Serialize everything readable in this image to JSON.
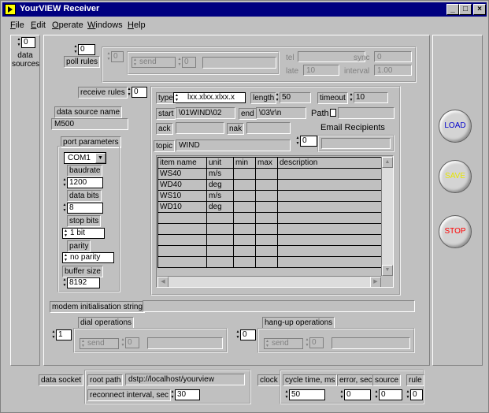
{
  "window": {
    "title": "YourVIEW Receiver",
    "minimize_glyph": "_",
    "maximize_glyph": "□",
    "close_glyph": "×"
  },
  "menu": [
    "File",
    "Edit",
    "Operate",
    "Windows",
    "Help"
  ],
  "data_sources": {
    "index": "0",
    "label": "data sources"
  },
  "poll_rules": {
    "label": "poll rules",
    "index": "0",
    "inner_index": "0",
    "mode": "send",
    "mode_index": "0",
    "fields": {
      "tel_label": "tel",
      "tel_value": "",
      "sync_label": "sync",
      "sync_value": "0",
      "late_label": "late",
      "late_value": "10",
      "interval_label": "interval",
      "interval_value": "1.00"
    }
  },
  "receive_rules": {
    "label": "receive rules",
    "index": "0",
    "type_label": "type",
    "type_value": "lxx.xlxx.xlxx.x",
    "length_label": "length",
    "length_value": "50",
    "timeout_label": "timeout",
    "timeout_value": "10",
    "start_label": "start",
    "start_value": "\\01WIND\\02",
    "end_label": "end",
    "end_value": "\\03\\r\\n",
    "path_label": "Path",
    "path_value": "",
    "ack_label": "ack",
    "ack_value": "",
    "nak_label": "nak",
    "nak_value": "",
    "email_label": "Email Recipients",
    "email_index": "0",
    "email_value": "",
    "topic_label": "topic",
    "topic_value": "WIND",
    "items_table": {
      "columns": [
        "item name",
        "unit",
        "min",
        "max",
        "description"
      ],
      "rows": [
        [
          "WS40",
          "m/s",
          "",
          "",
          ""
        ],
        [
          "WD40",
          "deg",
          "",
          "",
          ""
        ],
        [
          "WS10",
          "m/s",
          "",
          "",
          ""
        ],
        [
          "WD10",
          "deg",
          "",
          "",
          ""
        ],
        [
          "",
          "",
          "",
          "",
          ""
        ],
        [
          "",
          "",
          "",
          "",
          ""
        ],
        [
          "",
          "",
          "",
          "",
          ""
        ],
        [
          "",
          "",
          "",
          "",
          ""
        ],
        [
          "",
          "",
          "",
          "",
          ""
        ]
      ]
    }
  },
  "data_source_name": {
    "label": "data source name",
    "value": "M500"
  },
  "port_parameters": {
    "label": "port parameters",
    "port": "COM1",
    "baudrate_label": "baudrate",
    "baudrate": "1200",
    "data_bits_label": "data bits",
    "data_bits": "8",
    "stop_bits_label": "stop bits",
    "stop_bits": "1 bit",
    "parity_label": "parity",
    "parity": "no parity",
    "buffer_size_label": "buffer size",
    "buffer_size": "8192"
  },
  "modem": {
    "init_label": "modem initialisation string",
    "init_value": "",
    "dial_label": "dial operations",
    "dial_index": "1",
    "dial_mode": "send",
    "dial_mode_index": "0",
    "hangup_label": "hang-up operations",
    "hangup_index": "0",
    "hangup_mode": "send",
    "hangup_mode_index": "0"
  },
  "buttons": {
    "load": "LOAD",
    "save": "SAVE",
    "stop": "STOP"
  },
  "colors": {
    "load": "#0000cc",
    "save": "#e6e600",
    "stop": "#ff0000",
    "title_bar": "#000080"
  },
  "data_socket": {
    "label": "data socket",
    "root_path_label": "root path",
    "root_path": "dstp://localhost/yourview",
    "reconnect_label": "reconnect interval, sec",
    "reconnect": "30"
  },
  "clock": {
    "label": "clock",
    "cycle_label": "cycle time, ms",
    "cycle": "50",
    "error_label": "error, sec",
    "error": "0",
    "source_label": "source",
    "source": "0",
    "rule_label": "rule",
    "rule": "0"
  }
}
